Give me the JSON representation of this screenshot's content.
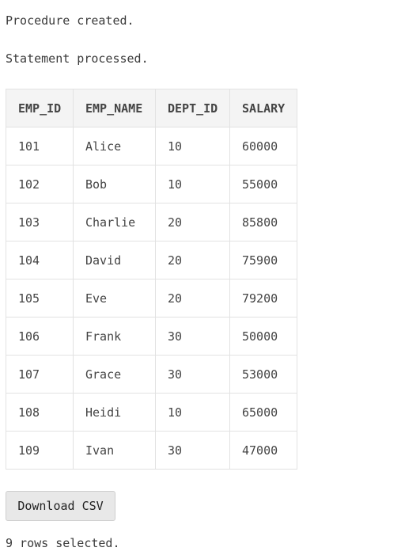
{
  "messages": {
    "procedure": "Procedure created.",
    "statement": "Statement processed.",
    "rows_selected": "9 rows selected."
  },
  "table": {
    "columns": [
      "EMP_ID",
      "EMP_NAME",
      "DEPT_ID",
      "SALARY"
    ],
    "rows": [
      [
        "101",
        "Alice",
        "10",
        "60000"
      ],
      [
        "102",
        "Bob",
        "10",
        "55000"
      ],
      [
        "103",
        "Charlie",
        "20",
        "85800"
      ],
      [
        "104",
        "David",
        "20",
        "75900"
      ],
      [
        "105",
        "Eve",
        "20",
        "79200"
      ],
      [
        "106",
        "Frank",
        "30",
        "50000"
      ],
      [
        "107",
        "Grace",
        "30",
        "53000"
      ],
      [
        "108",
        "Heidi",
        "10",
        "65000"
      ],
      [
        "109",
        "Ivan",
        "30",
        "47000"
      ]
    ]
  },
  "download_button": {
    "label": "Download CSV"
  }
}
